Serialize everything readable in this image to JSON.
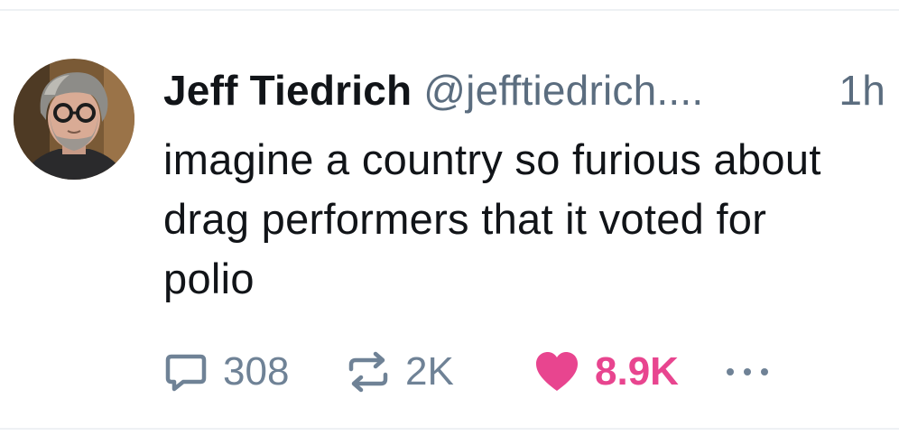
{
  "post": {
    "author": {
      "display_name": "Jeff Tiedrich",
      "handle": "@jefftiedrich....",
      "avatar_icon": "avatar-photo"
    },
    "timestamp": "1h",
    "text": "imagine a country so furious about drag performers that it voted for polio",
    "actions": {
      "reply": {
        "icon": "speech-bubble-icon",
        "count": "308"
      },
      "repost": {
        "icon": "repost-arrows-icon",
        "count": "2K"
      },
      "like": {
        "icon": "heart-icon",
        "count": "8.9K",
        "liked": true
      },
      "more": {
        "icon": "ellipsis-icon"
      }
    }
  },
  "colors": {
    "text_primary": "#111418",
    "text_secondary": "#5b6d7f",
    "action_gray": "#6f8296",
    "like_pink": "#e8458f",
    "divider": "#eef1f4"
  }
}
